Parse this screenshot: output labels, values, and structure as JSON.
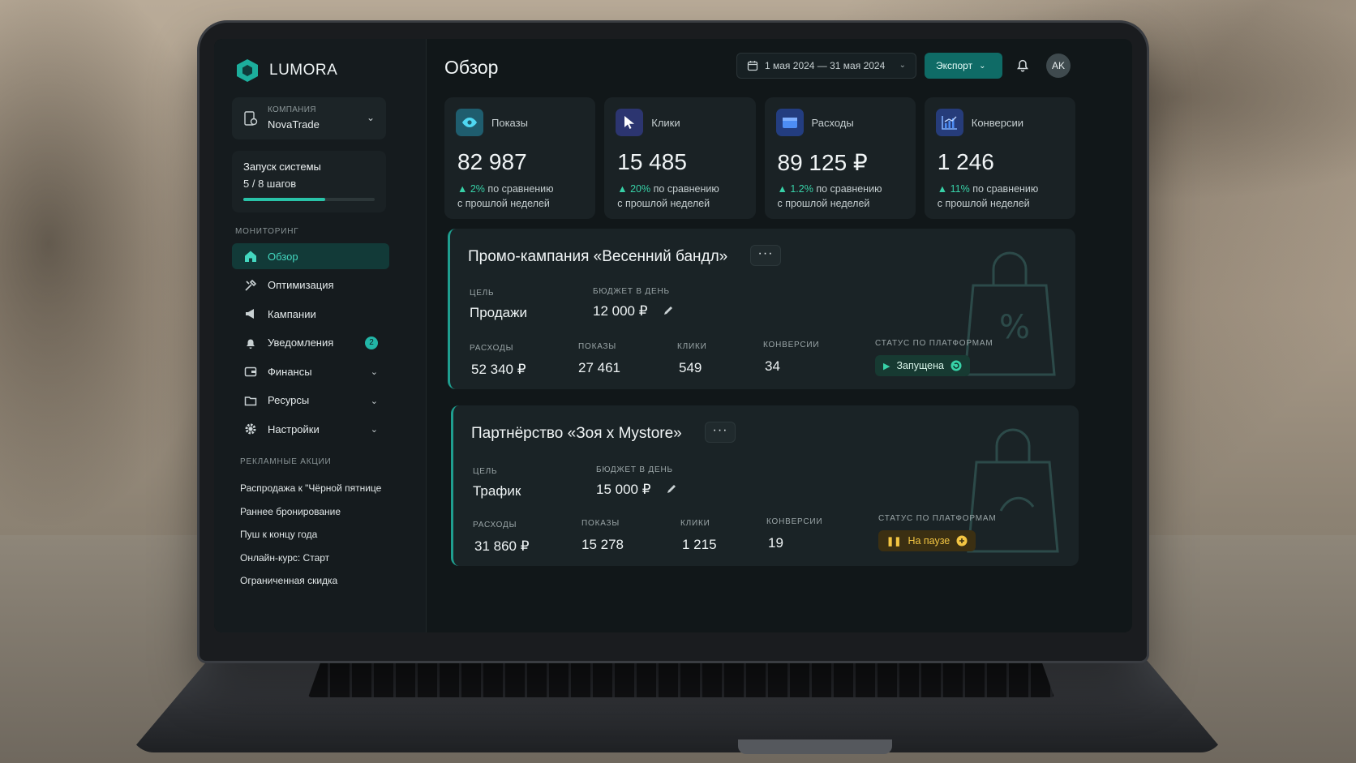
{
  "brand": {
    "name": "LUMORA"
  },
  "company": {
    "caption": "КОМПАНИЯ",
    "value": "NovaTrade"
  },
  "onboarding": {
    "title": "Запуск системы",
    "progress_text": "5 / 8 шагов",
    "progress": 0.625
  },
  "sidebar": {
    "monitoring_label": "МОНИТОРИНГ",
    "items": [
      {
        "label": "Обзор",
        "icon": "home-icon",
        "active": true
      },
      {
        "label": "Оптимизация",
        "icon": "tools-icon"
      },
      {
        "label": "Кампании",
        "icon": "megaphone-icon"
      },
      {
        "label": "Уведомления",
        "icon": "bell-icon",
        "badge": "2"
      },
      {
        "label": "Финансы",
        "icon": "wallet-icon",
        "expandable": true
      },
      {
        "label": "Ресурсы",
        "icon": "folder-icon",
        "expandable": true
      },
      {
        "label": "Настройки",
        "icon": "gear-icon",
        "expandable": true
      }
    ],
    "promos_label": "РЕКЛАМНЫЕ АКЦИИ",
    "promos": [
      "Распродажа к \"Чёрной пятнице",
      "Раннее бронирование",
      "Пуш к концу года",
      "Онлайн-курс: Старт",
      "Ограниченная скидка"
    ]
  },
  "header": {
    "title": "Обзор",
    "date_range": "1 мая 2024 — 31 мая 2024",
    "export_label": "Экспорт",
    "avatar_initials": "AK"
  },
  "kpis": [
    {
      "label": "Показы",
      "value": "82 987",
      "delta": "2%",
      "delta_text": "по сравнению",
      "delta_text2": "с прошлой неделей",
      "icon": "eye-icon",
      "color": "#1f5d6e"
    },
    {
      "label": "Клики",
      "value": "15 485",
      "delta": "20%",
      "delta_text": "по сравнению",
      "delta_text2": "с прошлой неделей",
      "icon": "cursor-icon",
      "color": "#2c3570"
    },
    {
      "label": "Расходы",
      "value": "89 125 ₽",
      "delta": "1.2%",
      "delta_text": "по сравнению",
      "delta_text2": "с прошлой неделей",
      "icon": "wallet-icon",
      "color": "#233d80"
    },
    {
      "label": "Конверсии",
      "value": "1 246",
      "delta": "11%",
      "delta_text": "по сравнению",
      "delta_text2": "с прошлой неделей",
      "icon": "chart-icon",
      "color": "#263c7a"
    }
  ],
  "labels": {
    "goal": "ЦЕЛЬ",
    "budget": "БЮДЖЕТ В ДЕНЬ",
    "spend": "РАСХОДЫ",
    "impressions": "ПОКАЗЫ",
    "clicks": "КЛИКИ",
    "conversions": "КОНВЕРСИИ",
    "status": "СТАТУС ПО ПЛАТФОРМАМ"
  },
  "campaigns": [
    {
      "title": "Промо-кампания «Весенний бандл»",
      "more": "···",
      "goal": "Продажи",
      "budget": "12 000 ₽",
      "spend": "52 340 ₽",
      "impressions": "27 461",
      "clicks": "549",
      "conversions": "34",
      "status": "Запущена",
      "status_color": "#37d1a7"
    },
    {
      "title": "Партнёрство «Зоя х Mystore»",
      "more": "···",
      "goal": "Трафик",
      "budget": "15 000 ₽",
      "spend": "31 860 ₽",
      "impressions": "15 278",
      "clicks": "1 215",
      "conversions": "19",
      "status": "На паузе",
      "status_color": "#f3c542"
    }
  ]
}
